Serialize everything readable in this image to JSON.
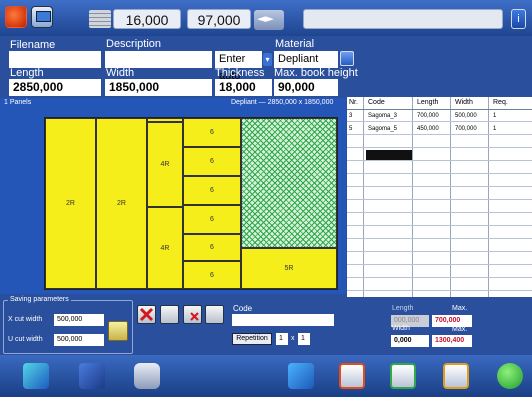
{
  "topbar": {
    "counter_1": "16,000",
    "counter_2": "97,000"
  },
  "form": {
    "filename_label": "Filename",
    "description_label": "Description",
    "material_label": "Material",
    "enter_auto": "Enter auto",
    "material_value": "Depliant",
    "length_label": "Length",
    "width_label": "Width",
    "thickness_label": "Thickness",
    "max_book_label": "Max. book height",
    "length_value": "2850,000",
    "width_value": "1850,000",
    "thickness_value": "18,000",
    "max_book_value": "90,000"
  },
  "canvas": {
    "panels_label": "1 Panels",
    "header_info": "Depliant — 2850,000 x 1850,000",
    "pieces": [
      "2R",
      "2R",
      "4R",
      "4R",
      "6",
      "6",
      "6",
      "6",
      "6",
      "6",
      "5R"
    ]
  },
  "table": {
    "headers": [
      "Nr.",
      "Code",
      "Length",
      "Width",
      "Req."
    ],
    "rows": [
      [
        "3",
        "Sagoma_3",
        "700,000",
        "500,000",
        "1"
      ],
      [
        "5",
        "Sagoma_5",
        "450,000",
        "700,000",
        "1"
      ]
    ]
  },
  "saving": {
    "title": "Saving parameters",
    "x_cut_label": "X cut width",
    "x_cut_value": "500,000",
    "u_cut_label": "U cut width",
    "u_cut_value": "500,000"
  },
  "code": {
    "label": "Code",
    "repetition_label": "Repetition",
    "repetition_value": "1",
    "times_sign": "x",
    "times_value": "1"
  },
  "dims": {
    "length_label": "Length",
    "length_min": "000,000",
    "max_label_1": "Max.",
    "length_max": "700,000",
    "width_label": "Width",
    "width_min": "0,000",
    "max_label_2": "Max.",
    "width_max": "1300,400"
  },
  "colors": {
    "background": "#2a4f9c",
    "sheet": "#f3ec1a",
    "accent_red": "#c8102e"
  }
}
